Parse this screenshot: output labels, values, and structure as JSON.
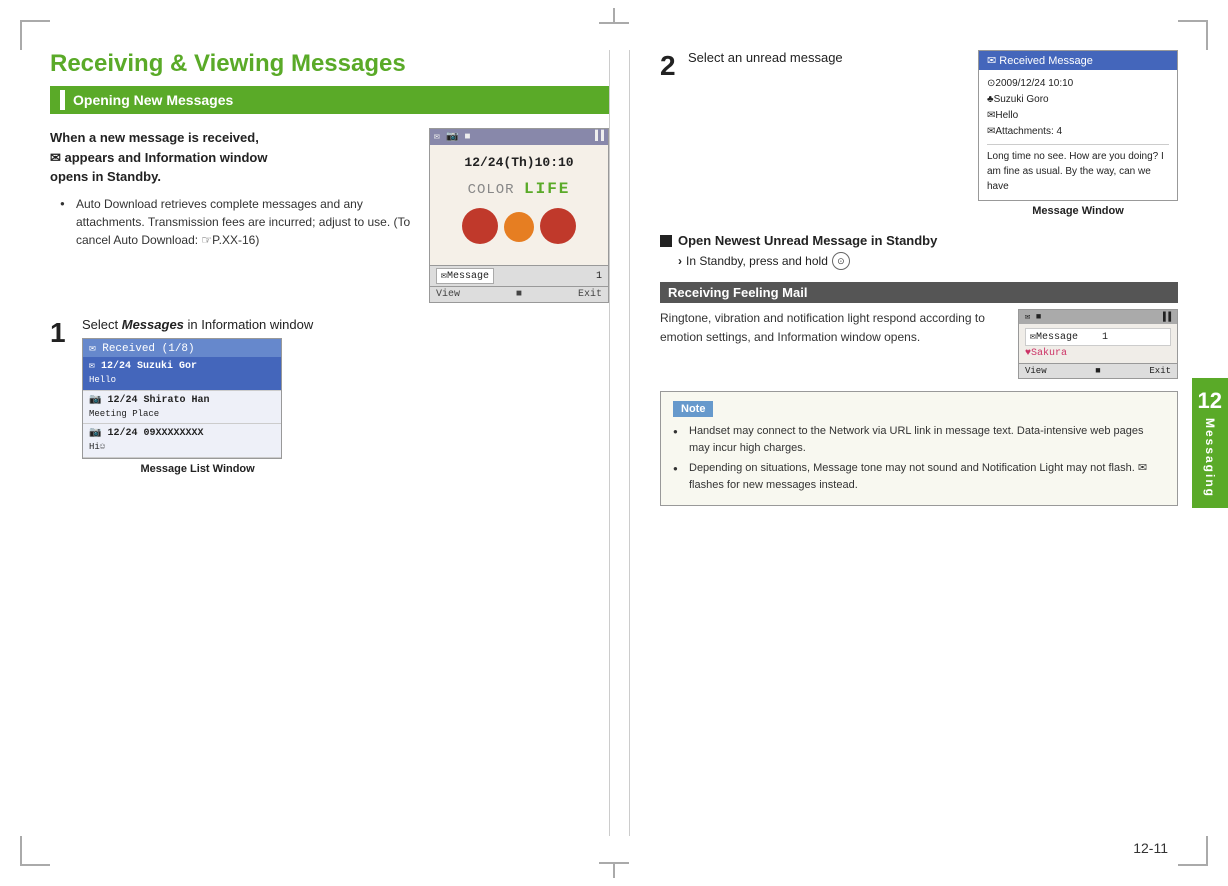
{
  "page": {
    "title": "Receiving & Viewing Messages",
    "section_header": "Opening New Messages",
    "chapter_number": "12",
    "chapter_label": "Messaging",
    "page_number": "12-11"
  },
  "left": {
    "intro_bold": "When a new message is received, ✉ appears and Information window opens in Standby.",
    "bullets": [
      "Auto Download retrieves complete messages and any attachments. Transmission fees are incurred; adjust to use. (To cancel Auto Download: ☞P.XX-16)"
    ],
    "phone1": {
      "time": "12/24(Th)10:10",
      "logo_color": "COLOR",
      "logo_life": "LIFE",
      "bottom_msg": "✉Message",
      "bottom_num": "1",
      "buttons": [
        "View",
        "■",
        "Exit"
      ]
    },
    "step1": {
      "number": "1",
      "text": "Select Messages in Information window",
      "caption": "Message List Window"
    },
    "msg_list": {
      "header": "✉ Received (1/8)",
      "items": [
        {
          "date": "12/24",
          "from": "Suzuki Gor",
          "subject": "Hello",
          "selected": true
        },
        {
          "date": "12/24",
          "from": "Shirato Han",
          "subject": "Meeting Place",
          "selected": false
        },
        {
          "date": "12/24",
          "from": "09XXXXXXXX",
          "subject": "Hi☺",
          "selected": false
        }
      ]
    }
  },
  "right": {
    "step2": {
      "number": "2",
      "text": "Select an unread message"
    },
    "recv_message": {
      "header": "✉ Received Message",
      "date": "⊙2009/12/24 10:10",
      "from": "♣Suzuki Goro",
      "subject": "✉Hello",
      "attach": "✉Attachments: 4",
      "body": "Long time no see. How are you doing? I am fine as usual. By the way, can we have",
      "caption": "Message Window"
    },
    "open_newest": {
      "title": "Open Newest Unread Message in Standby",
      "sub": "In Standby, press and hold ⊙"
    },
    "feeling_mail": {
      "header": "Receiving Feeling Mail",
      "text": "Ringtone, vibration and notification light respond according to emotion settings, and Information window opens.",
      "phone": {
        "msg": "✉Message",
        "num": "1",
        "sakura": "♥Sakura",
        "buttons": [
          "View",
          "■",
          "Exit"
        ]
      }
    },
    "note": {
      "label": "Note",
      "items": [
        "Handset may connect to the Network via URL link in message text. Data-intensive web pages may incur high charges.",
        "Depending on situations, Message tone may not sound and Notification Light may not flash. ✉ flashes for new messages instead."
      ]
    }
  },
  "icons": {
    "bullet": "●",
    "arrow": "›",
    "envelope": "✉",
    "circle_btn": "⊙"
  }
}
